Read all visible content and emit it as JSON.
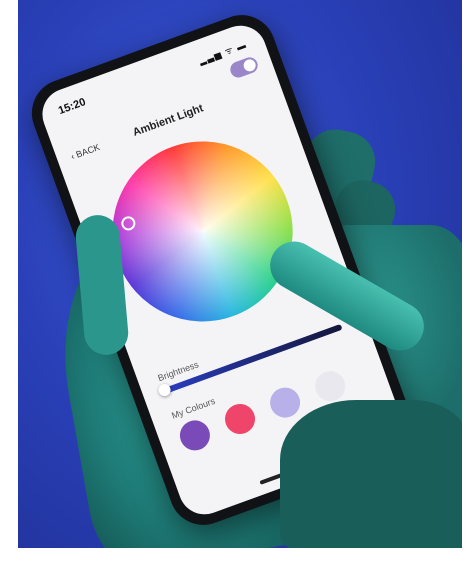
{
  "app": {
    "status_time": "15:20",
    "status_icons": "▂▃▅ ᯤ ▬",
    "title": "Ambient Light",
    "back_label": "BACK",
    "power_toggle": "on"
  },
  "controls": {
    "brightness_label": "Brightness",
    "brightness_level": 0.05,
    "my_colours_label": "My Colours"
  },
  "colours": {
    "swatch_1": "#7a4ab8",
    "swatch_2": "#f0456a",
    "swatch_3": "#b8b0e8",
    "swatch_4": "#e8e8ee",
    "background": "#2a40b8",
    "hand": "#1e7a76"
  },
  "icons": [
    "back-chevron-icon",
    "signal-icon",
    "wifi-icon",
    "battery-icon",
    "toggle-switch"
  ]
}
